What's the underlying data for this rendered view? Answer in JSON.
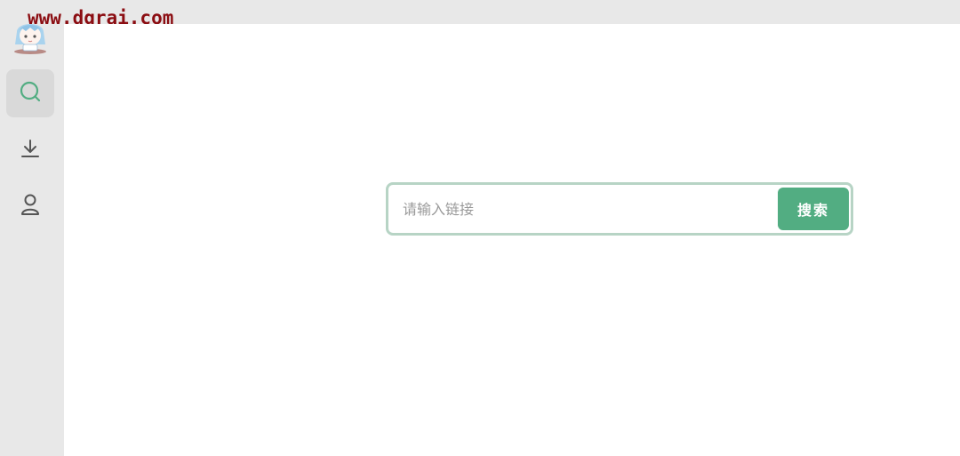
{
  "watermark": {
    "text": "www.dgrai.com"
  },
  "sidebar": {
    "items": [
      {
        "icon": "search-icon",
        "active": true
      },
      {
        "icon": "download-icon",
        "active": false
      },
      {
        "icon": "user-icon",
        "active": false
      }
    ]
  },
  "search": {
    "placeholder": "请输入链接",
    "value": "",
    "button_label": "搜索"
  },
  "colors": {
    "accent": "#52ad82",
    "sidebar_bg": "#e8e8e8",
    "active_item_bg": "#d9d9d9",
    "watermark": "#8b0d12"
  }
}
